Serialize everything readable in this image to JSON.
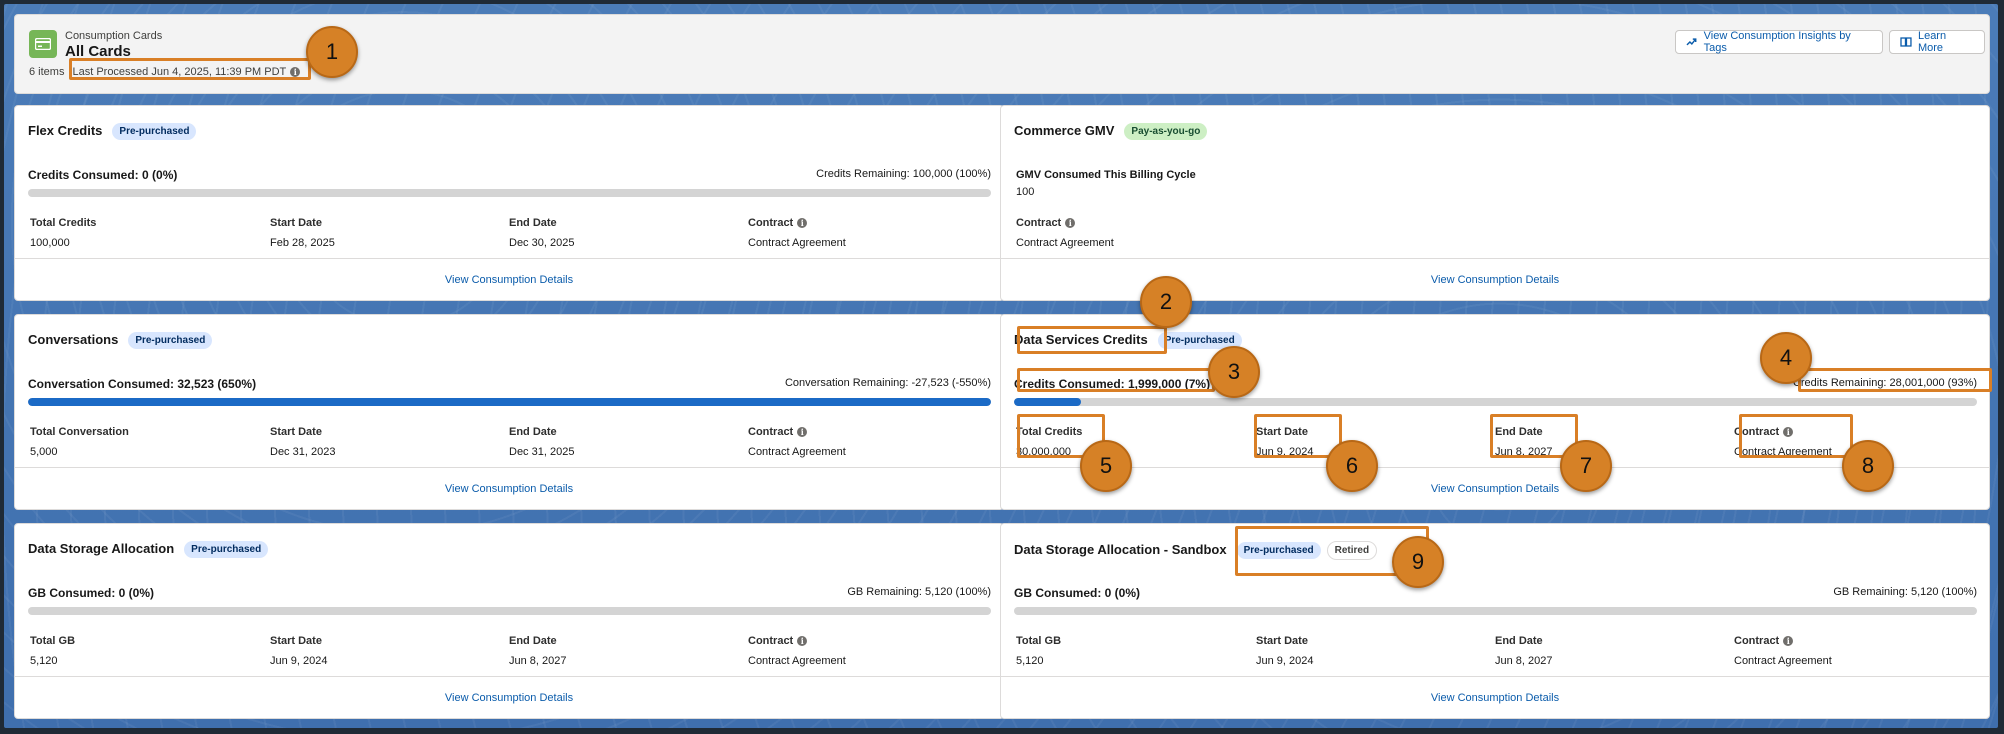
{
  "header": {
    "eyebrow": "Consumption Cards",
    "title": "All Cards",
    "items_count": "6 items",
    "last_processed": "Last Processed Jun 4, 2025, 11:39 PM PDT",
    "btn_insights": "View Consumption Insights by Tags",
    "btn_learn": "Learn More"
  },
  "cards": {
    "flex": {
      "title": "Flex Credits",
      "badge": "Pre-purchased",
      "consumed": "Credits Consumed: 0 (0%)",
      "remaining": "Credits Remaining: 100,000 (100%)",
      "progress": 0,
      "f1_label": "Total Credits",
      "f1_value": "100,000",
      "f2_label": "Start Date",
      "f2_value": "Feb 28, 2025",
      "f3_label": "End Date",
      "f3_value": "Dec 30, 2025",
      "f4_label": "Contract",
      "f4_value": "Contract Agreement",
      "link": "View Consumption Details"
    },
    "gmv": {
      "title": "Commerce GMV",
      "badge": "Pay-as-you-go",
      "gmv_label": "GMV Consumed This Billing Cycle",
      "gmv_value": "100",
      "contract_label": "Contract",
      "contract_value": "Contract Agreement",
      "link": "View Consumption Details"
    },
    "conv": {
      "title": "Conversations",
      "badge": "Pre-purchased",
      "consumed": "Conversation Consumed: 32,523 (650%)",
      "remaining": "Conversation Remaining: -27,523 (-550%)",
      "progress": 1,
      "f1_label": "Total Conversation",
      "f1_value": "5,000",
      "f2_label": "Start Date",
      "f2_value": "Dec 31, 2023",
      "f3_label": "End Date",
      "f3_value": "Dec 31, 2025",
      "f4_label": "Contract",
      "f4_value": "Contract Agreement",
      "link": "View Consumption Details"
    },
    "dsc": {
      "title": "Data Services Credits",
      "badge": "Pre-purchased",
      "consumed": "Credits Consumed: 1,999,000 (7%)",
      "remaining": "Credits Remaining: 28,001,000 (93%)",
      "progress": 0.07,
      "f1_label": "Total Credits",
      "f1_value": "30,000,000",
      "f2_label": "Start Date",
      "f2_value": "Jun 9, 2024",
      "f3_label": "End Date",
      "f3_value": "Jun 8, 2027",
      "f4_label": "Contract",
      "f4_value": "Contract Agreement",
      "link": "View Consumption Details"
    },
    "dsa": {
      "title": "Data Storage Allocation",
      "badge": "Pre-purchased",
      "consumed": "GB Consumed: 0 (0%)",
      "remaining": "GB Remaining: 5,120 (100%)",
      "progress": 0,
      "f1_label": "Total GB",
      "f1_value": "5,120",
      "f2_label": "Start Date",
      "f2_value": "Jun 9, 2024",
      "f3_label": "End Date",
      "f3_value": "Jun 8, 2027",
      "f4_label": "Contract",
      "f4_value": "Contract Agreement",
      "link": "View Consumption Details"
    },
    "dsas": {
      "title": "Data Storage Allocation - Sandbox",
      "badge": "Pre-purchased",
      "badge2": "Retired",
      "consumed": "GB Consumed: 0 (0%)",
      "remaining": "GB Remaining: 5,120 (100%)",
      "progress": 0,
      "f1_label": "Total GB",
      "f1_value": "5,120",
      "f2_label": "Start Date",
      "f2_value": "Jun 9, 2024",
      "f3_label": "End Date",
      "f3_value": "Jun 8, 2027",
      "f4_label": "Contract",
      "f4_value": "Contract Agreement",
      "link": "View Consumption Details"
    }
  },
  "callouts": [
    "1",
    "2",
    "3",
    "4",
    "5",
    "6",
    "7",
    "8",
    "9"
  ],
  "colors": {
    "accent": "#0b5cab",
    "callout": "#d68126",
    "bar_fill": "#1b6ac6"
  }
}
